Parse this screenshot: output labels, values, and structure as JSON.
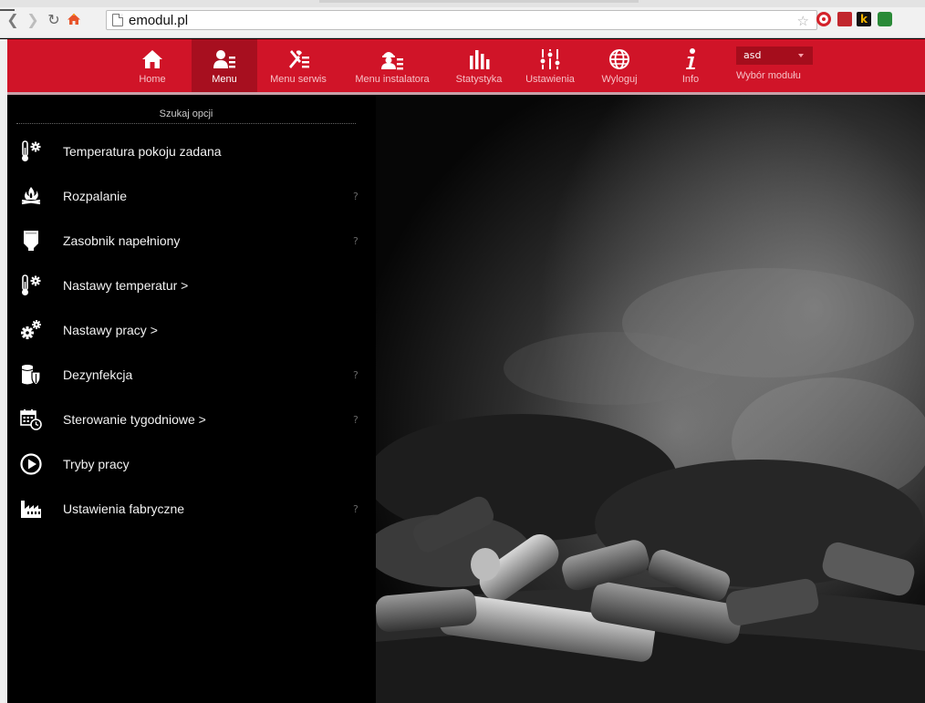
{
  "browser": {
    "url": "emodul.pl"
  },
  "nav": {
    "items": [
      {
        "label": "Home",
        "icon": "home-icon"
      },
      {
        "label": "Menu",
        "icon": "user-menu-icon"
      },
      {
        "label": "Menu serwis",
        "icon": "tools-icon"
      },
      {
        "label": "Menu instalatora",
        "icon": "installer-icon"
      },
      {
        "label": "Statystyka",
        "icon": "bar-chart-icon"
      },
      {
        "label": "Ustawienia",
        "icon": "sliders-icon"
      },
      {
        "label": "Wyloguj",
        "icon": "globe-icon"
      },
      {
        "label": "Info",
        "icon": "info-icon"
      }
    ],
    "active": "Menu",
    "module": {
      "selected": "asd",
      "label": "Wybór modułu"
    }
  },
  "sidebar": {
    "search_label": "Szukaj opcji",
    "items": [
      {
        "label": "Temperatura pokoju zadana",
        "icon": "thermometer-gear-icon",
        "help": ""
      },
      {
        "label": "Rozpalanie",
        "icon": "fire-icon",
        "help": "?"
      },
      {
        "label": "Zasobnik napełniony",
        "icon": "hopper-icon",
        "help": "?"
      },
      {
        "label": "Nastawy temperatur >",
        "icon": "thermometer-gear-icon",
        "help": ""
      },
      {
        "label": "Nastawy pracy >",
        "icon": "gears-icon",
        "help": ""
      },
      {
        "label": "Dezynfekcja",
        "icon": "tank-shield-icon",
        "help": "?"
      },
      {
        "label": "Sterowanie tygodniowe >",
        "icon": "calendar-clock-icon",
        "help": "?"
      },
      {
        "label": "Tryby pracy",
        "icon": "play-circle-icon",
        "help": ""
      },
      {
        "label": "Ustawienia fabryczne",
        "icon": "factory-icon",
        "help": "?"
      }
    ]
  },
  "colors": {
    "accent": "#d01428",
    "accent_dark": "#a70f1f",
    "sidebar_bg": "#000000"
  }
}
